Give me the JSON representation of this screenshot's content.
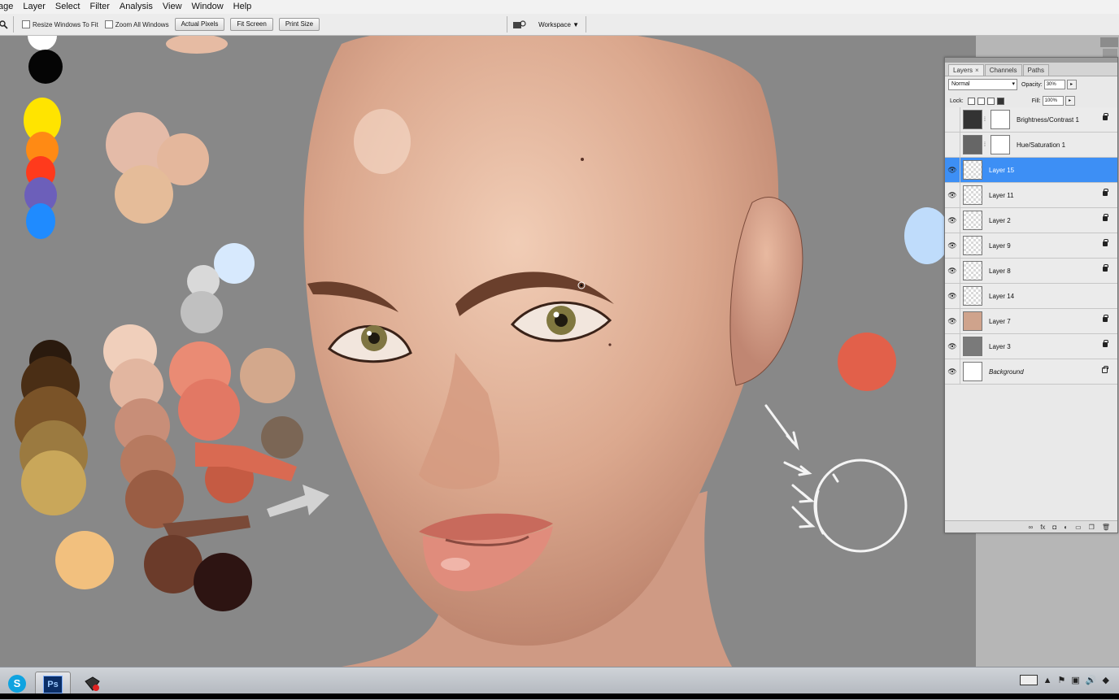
{
  "menu": [
    "age",
    "Layer",
    "Select",
    "Filter",
    "Analysis",
    "View",
    "Window",
    "Help"
  ],
  "options": {
    "resize_windows_label": "Resize Windows To Fit",
    "zoom_all_label": "Zoom All Windows",
    "actual_pixels": "Actual Pixels",
    "fit_screen": "Fit Screen",
    "print_size": "Print Size",
    "workspace": "Workspace ▼"
  },
  "layers_panel": {
    "tabs": [
      "Layers",
      "Channels",
      "Paths"
    ],
    "blend_mode": "Normal",
    "opacity_label": "Opacity:",
    "opacity_value": "30%",
    "lock_label": "Lock:",
    "fill_label": "Fill:",
    "fill_value": "100%",
    "layers": [
      {
        "name": "Brightness/Contrast 1",
        "visible": false,
        "selected": false
      },
      {
        "name": "Hue/Saturation 1",
        "visible": false,
        "selected": false
      },
      {
        "name": "Layer 15",
        "visible": true,
        "selected": true
      },
      {
        "name": "Layer 11",
        "visible": true,
        "selected": false
      },
      {
        "name": "Layer 2",
        "visible": true,
        "selected": false
      },
      {
        "name": "Layer 9",
        "visible": true,
        "selected": false
      },
      {
        "name": "Layer 8",
        "visible": true,
        "selected": false
      },
      {
        "name": "Layer 14",
        "visible": true,
        "selected": false
      },
      {
        "name": "Layer 7",
        "visible": true,
        "selected": false
      },
      {
        "name": "Layer 3",
        "visible": true,
        "selected": false
      },
      {
        "name": "Background",
        "visible": true,
        "selected": false
      }
    ],
    "footer_icons": [
      "link-icon",
      "fx-icon",
      "mask-icon",
      "adjustment-icon",
      "folder-icon",
      "new-layer-icon",
      "trash-icon"
    ]
  },
  "taskbar": {
    "ps_label": "Ps",
    "skype_label": "S"
  },
  "colors": {
    "selected_layer": "#3d8ff5",
    "canvas_gray": "#888888"
  }
}
